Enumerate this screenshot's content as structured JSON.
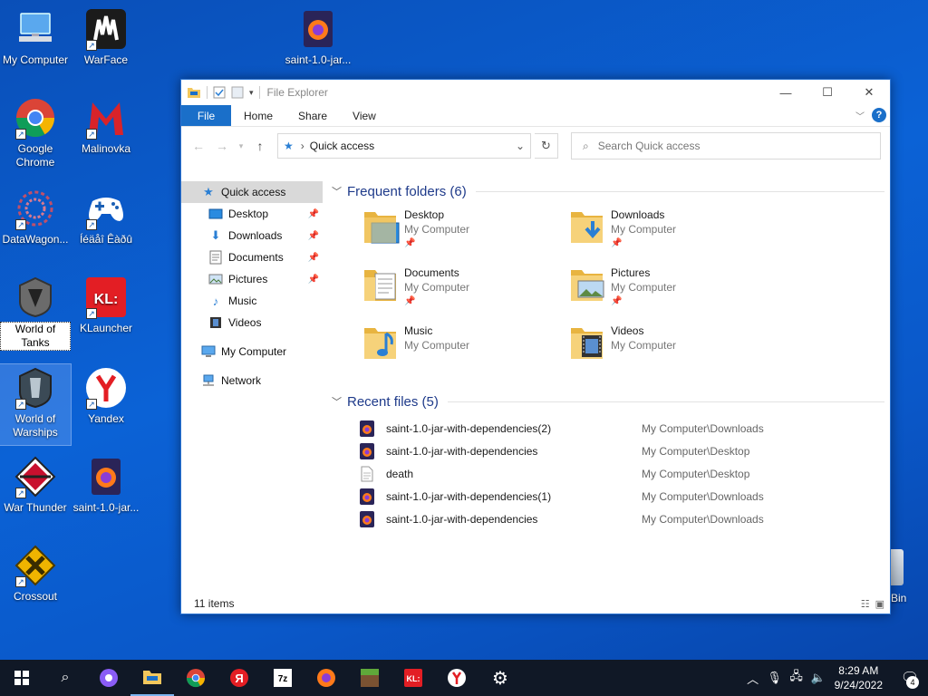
{
  "desktop": {
    "icons": [
      {
        "label": "My Computer"
      },
      {
        "label": "WarFace"
      },
      {
        "label": "saint-1.0-jar..."
      },
      {
        "label": "Google Chrome"
      },
      {
        "label": "Malinovka"
      },
      {
        "label": "DataWagon..."
      },
      {
        "label": "Íéäåî Êàðû"
      },
      {
        "label": "World of Tanks"
      },
      {
        "label": "KLauncher"
      },
      {
        "label": "World of Warships"
      },
      {
        "label": "Yandex"
      },
      {
        "label": "War Thunder"
      },
      {
        "label": "saint-1.0-jar..."
      },
      {
        "label": "Crossout"
      },
      {
        "label": "Bin"
      }
    ]
  },
  "explorer": {
    "title": "File Explorer",
    "ribbon_tabs": [
      "File",
      "Home",
      "Share",
      "View"
    ],
    "address": "Quick access",
    "search_placeholder": "Search Quick access",
    "sidebar": {
      "quick_access": "Quick access",
      "items": [
        {
          "label": "Desktop",
          "pinned": true
        },
        {
          "label": "Downloads",
          "pinned": true
        },
        {
          "label": "Documents",
          "pinned": true
        },
        {
          "label": "Pictures",
          "pinned": true
        },
        {
          "label": "Music",
          "pinned": false
        },
        {
          "label": "Videos",
          "pinned": false
        }
      ],
      "my_computer": "My Computer",
      "network": "Network"
    },
    "frequent_header": "Frequent folders (6)",
    "frequent": [
      {
        "name": "Desktop",
        "location": "My Computer",
        "pinned": true
      },
      {
        "name": "Downloads",
        "location": "My Computer",
        "pinned": true
      },
      {
        "name": "Documents",
        "location": "My Computer",
        "pinned": true
      },
      {
        "name": "Pictures",
        "location": "My Computer",
        "pinned": true
      },
      {
        "name": "Music",
        "location": "My Computer",
        "pinned": false
      },
      {
        "name": "Videos",
        "location": "My Computer",
        "pinned": false
      }
    ],
    "recent_header": "Recent files (5)",
    "recent": [
      {
        "name": "saint-1.0-jar-with-dependencies(2)",
        "location": "My Computer\\Downloads",
        "icon": "firefox-icon"
      },
      {
        "name": "saint-1.0-jar-with-dependencies",
        "location": "My Computer\\Desktop",
        "icon": "firefox-icon"
      },
      {
        "name": "death",
        "location": "My Computer\\Desktop",
        "icon": "text-file-icon"
      },
      {
        "name": "saint-1.0-jar-with-dependencies(1)",
        "location": "My Computer\\Downloads",
        "icon": "firefox-icon"
      },
      {
        "name": "saint-1.0-jar-with-dependencies",
        "location": "My Computer\\Downloads",
        "icon": "firefox-icon"
      }
    ],
    "status": "11 items"
  },
  "taskbar": {
    "time": "8:29 AM",
    "date": "9/24/2022",
    "notification_count": "4"
  },
  "colors": {
    "accent": "#1a6fc9",
    "desktop": "#0b62d6",
    "taskbar": "#101826",
    "folder": "#f2c75c"
  }
}
